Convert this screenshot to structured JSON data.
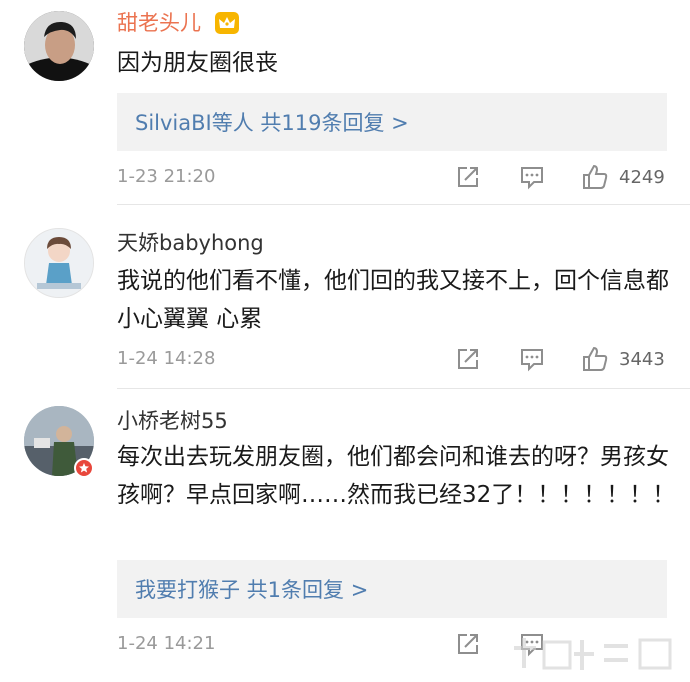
{
  "comments": [
    {
      "username": "甜老头儿",
      "text": "因为朋友圈很丧",
      "replies": "SilviaBI等人 共119条回复 >",
      "time": "1-23 21:20",
      "likes": "4249"
    },
    {
      "username": "天娇babyhong",
      "text": "我说的他们看不懂，他们回的我又接不上，回个信息都小心翼翼 心累",
      "time": "1-24 14:28",
      "likes": "3443"
    },
    {
      "username": "小桥老树55",
      "text": "每次出去玩发朋友圈，他们都会问和谁去的呀？男孩女孩啊？早点回家啊……然而我已经32了！！！！！！！",
      "replies": "我要打猴子 共1条回复 >",
      "time": "1-24 14:21"
    }
  ],
  "colors": {
    "vip_name": "#eb7350",
    "link": "#507daf",
    "icon": "#8e8e8e",
    "badge": "#f7b500",
    "verified": "#e8473c"
  },
  "icons": [
    "crown-vip-icon",
    "forward-icon",
    "comment-icon",
    "like-icon",
    "verified-badge-icon"
  ]
}
